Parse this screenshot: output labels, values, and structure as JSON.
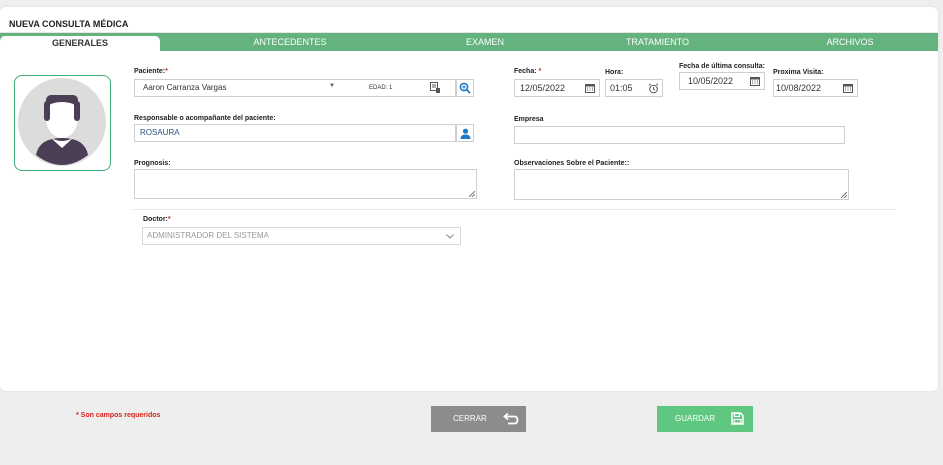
{
  "title": "NUEVA CONSULTA MÉDICA",
  "tabs": [
    {
      "label": "GENERALES",
      "active": true
    },
    {
      "label": "ANTECEDENTES"
    },
    {
      "label": "EXAMEN"
    },
    {
      "label": "TRATAMIENTO"
    },
    {
      "label": "ARCHIVOS"
    }
  ],
  "form": {
    "paciente": {
      "label": "Paciente:",
      "req": "*",
      "value": "Aaron Carranza Vargas",
      "edad": "EDAD: 1"
    },
    "responsable": {
      "label": "Responsable o acompañante del paciente:",
      "value": "ROSAURA"
    },
    "prognosis": {
      "label": "Prognosis:"
    },
    "fecha": {
      "label": "Fecha:",
      "req": "*",
      "value": "12/05/2022"
    },
    "hora": {
      "label": "Hora:",
      "value": "01:05"
    },
    "ultima": {
      "label": "Fecha de última consulta:",
      "value": "10/05/2022"
    },
    "proxima": {
      "label": "Proxima Visita:",
      "value": "10/08/2022"
    },
    "empresa": {
      "label": "Empresa",
      "value": ""
    },
    "observaciones": {
      "label": "Observaciones Sobre el Paciente::"
    },
    "doctor": {
      "label": "Doctor:",
      "req": "*",
      "value": "ADMINISTRADOR DEL SISTEMA"
    }
  },
  "footer": {
    "required_note": "* Son campos requeridos",
    "close_label": "CERRAR",
    "save_label": "GUARDAR"
  },
  "colors": {
    "accent": "#64b27e",
    "save": "#5fc77f",
    "close": "#8c8c8c",
    "required": "#d9221c",
    "link_blue": "#1f77c9"
  },
  "icons": [
    "avatar-placeholder-icon",
    "chevron-down-icon",
    "patient-card-icon",
    "search-plus-icon",
    "user-icon",
    "calendar-icon",
    "clock-icon",
    "resize-grip-icon",
    "return-arrow-icon",
    "save-icon"
  ]
}
